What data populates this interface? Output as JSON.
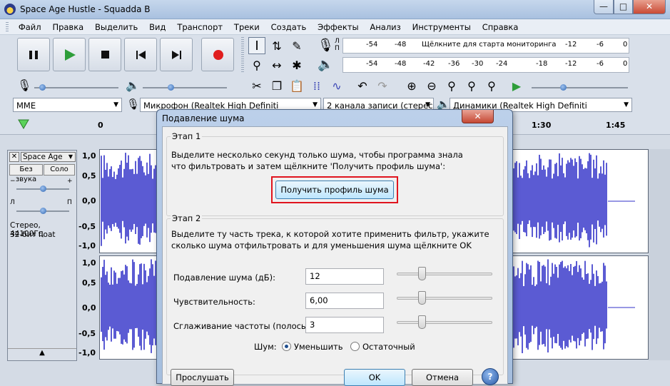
{
  "window": {
    "title": "Space Age Hustle - Squadda B",
    "min": "—",
    "max": "□",
    "close": "✕"
  },
  "menu": [
    "Файл",
    "Правка",
    "Выделить",
    "Вид",
    "Транспорт",
    "Треки",
    "Создать",
    "Эффекты",
    "Анализ",
    "Инструменты",
    "Справка"
  ],
  "meters": {
    "play_ticks": [
      "-54",
      "-48",
      "Щёлкните для старта мониторинга",
      "-12",
      "-6",
      "0"
    ],
    "rec_ticks": [
      "-54",
      "-48",
      "-42",
      "-36",
      "-30",
      "-24",
      "-18",
      "-12",
      "-6",
      "0"
    ],
    "lr": [
      "Л",
      "П"
    ]
  },
  "devices": {
    "host": "MME",
    "mic": "Микрофон (Realtek High Definiti",
    "channels": "2 канала записи (стерес",
    "speakers": "Динамики (Realtek High Definiti"
  },
  "timeline": [
    "0",
    "1:30",
    "1:45"
  ],
  "track": {
    "name": "Space Age",
    "mute": "Без звука",
    "solo": "Соло",
    "lr": [
      "Л",
      "П"
    ],
    "info_line1": "Стерео, 44100Гц",
    "info_line2": "32-бит float",
    "scale_top": [
      "1,0",
      "0,5",
      "0,0",
      "-0,5",
      "-1,0"
    ],
    "scale_bottom": [
      "1,0",
      "0,5",
      "0,0",
      "-0,5",
      "-1,0"
    ],
    "wave_color": "#3232c8"
  },
  "dialog": {
    "title": "Подавление шума",
    "step1_title": "Этап 1",
    "step1_line1": "Выделите несколько секунд только шума, чтобы программа знала",
    "step1_line2": "что фильтровать и затем щёлкните 'Получить профиль шума':",
    "get_profile": "Получить профиль шума",
    "step2_title": "Этап 2",
    "step2_line1": "Выделите ту часть трека, к которой хотите применить фильтр, укажите",
    "step2_line2": "сколько шума отфильтровать и для уменьшения шума щёлкните OK",
    "params": [
      {
        "label": "Подавление шума (дБ):",
        "value": "12"
      },
      {
        "label": "Чувствительность:",
        "value": "6,00"
      },
      {
        "label": "Сглаживание частоты (полосы)",
        "value": "3"
      }
    ],
    "noise_label": "Шум:",
    "noise_reduce": "Уменьшить",
    "noise_residue": "Остаточный",
    "preview": "Прослушать",
    "ok": "OK",
    "cancel": "Отмена",
    "help": "?",
    "highlight_color": "#e0141e"
  }
}
